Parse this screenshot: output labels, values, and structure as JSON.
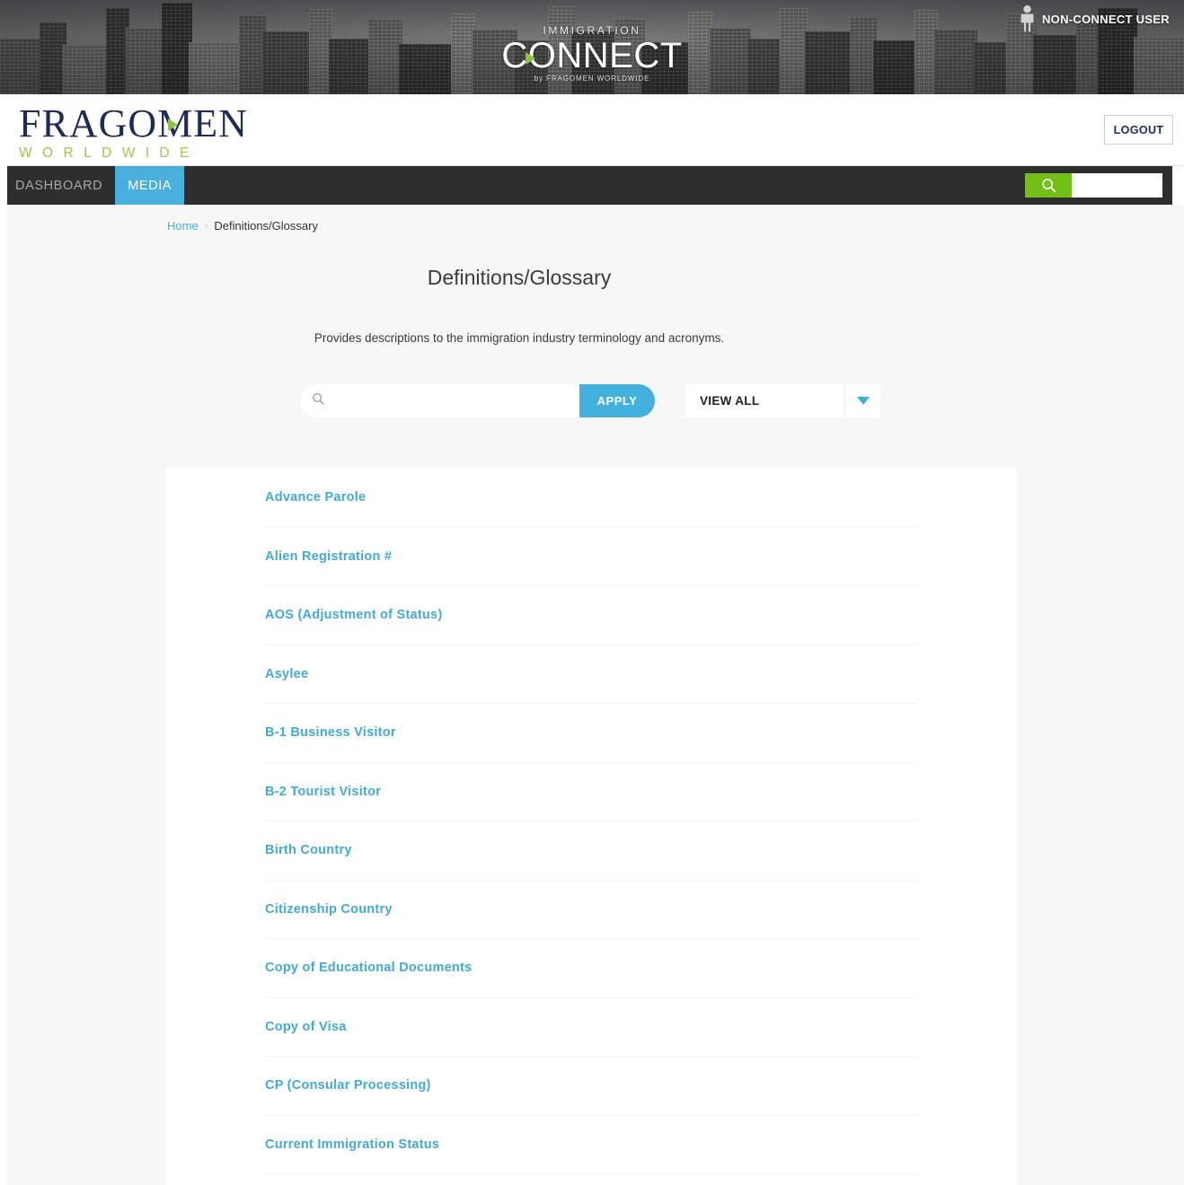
{
  "hero": {
    "brand_small": "IMMIGRATION",
    "brand_main": "CONNECT",
    "brand_by": "by FRAGOMEN WORLDWIDE",
    "user_label": "NON-CONNECT USER",
    "user_icon": "person-icon"
  },
  "logobar": {
    "logo_word": "FRAGOMEN",
    "logo_sub": "WORLDWIDE",
    "logout_label": "LOGOUT"
  },
  "nav": {
    "items": [
      {
        "label": "DASHBOARD",
        "active": false
      },
      {
        "label": "MEDIA",
        "active": true
      }
    ],
    "search_icon": "search-icon",
    "search_placeholder": "",
    "search_value": ""
  },
  "breadcrumb": {
    "home": "Home",
    "separator": "›",
    "current": "Definitions/Glossary"
  },
  "main": {
    "title": "Definitions/Glossary",
    "description": "Provides descriptions to the immigration industry terminology and acronyms.",
    "search": {
      "icon": "search-icon",
      "value": "",
      "placeholder": ""
    },
    "apply_label": "APPLY",
    "filter": {
      "selected": "VIEW ALL",
      "caret_icon": "chevron-down-icon"
    }
  },
  "glossary": {
    "items": [
      "Advance Parole",
      "Alien Registration #",
      "AOS (Adjustment of Status)",
      "Asylee",
      "B-1 Business Visitor",
      "B-2 Tourist Visitor",
      "Birth Country",
      "Citizenship Country",
      "Copy of Educational Documents",
      "Copy of Visa",
      "CP (Consular Processing)",
      "Current Immigration Status"
    ]
  },
  "colors": {
    "accent_blue": "#45a9d6",
    "nav_active": "#49b0dd",
    "brand_navy": "#1f2a55",
    "brand_green": "#8cc63f",
    "search_green": "#72bf16",
    "nav_dark": "#2e2e2e",
    "page_bg": "#f7f7f7"
  }
}
